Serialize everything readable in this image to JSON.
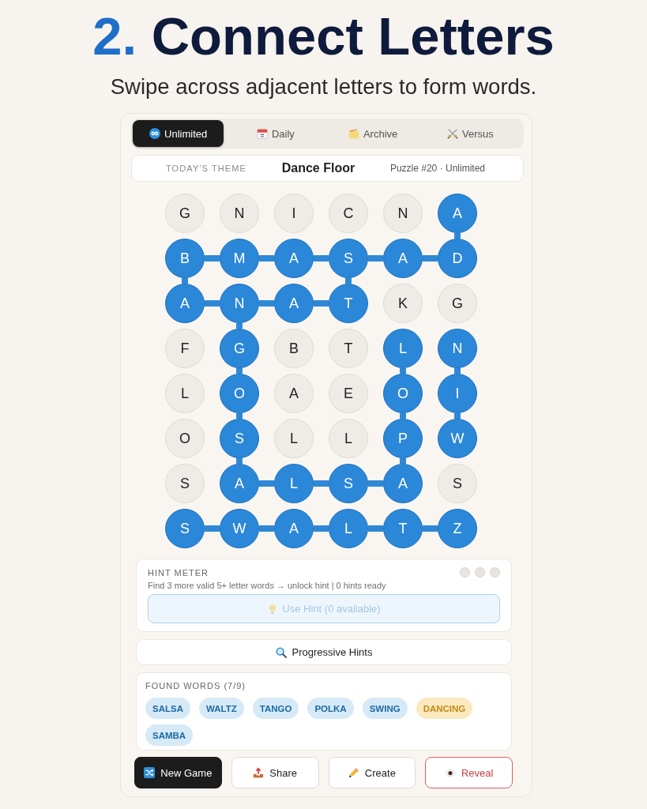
{
  "header": {
    "number": "2.",
    "title": "Connect Letters",
    "subtitle": "Swipe across adjacent letters to form words."
  },
  "tabs": [
    {
      "label": "Unlimited",
      "selected": true
    },
    {
      "label": "Daily",
      "selected": false
    },
    {
      "label": "Archive",
      "selected": false
    },
    {
      "label": "Versus",
      "selected": false
    }
  ],
  "theme_bar": {
    "label": "TODAY'S THEME",
    "theme": "Dance Floor",
    "puzzle": "Puzzle #20 · Unlimited"
  },
  "grid": {
    "rows": [
      [
        {
          "letter": "G",
          "selected": false,
          "link_right": false,
          "link_down": false
        },
        {
          "letter": "N",
          "selected": false,
          "link_right": false,
          "link_down": false
        },
        {
          "letter": "I",
          "selected": false,
          "link_right": false,
          "link_down": false
        },
        {
          "letter": "C",
          "selected": false,
          "link_right": false,
          "link_down": false
        },
        {
          "letter": "N",
          "selected": false,
          "link_right": false,
          "link_down": false
        },
        {
          "letter": "A",
          "selected": true,
          "link_right": false,
          "link_down": true
        }
      ],
      [
        {
          "letter": "B",
          "selected": true,
          "link_right": true,
          "link_down": true
        },
        {
          "letter": "M",
          "selected": true,
          "link_right": true,
          "link_down": false
        },
        {
          "letter": "A",
          "selected": true,
          "link_right": true,
          "link_down": false
        },
        {
          "letter": "S",
          "selected": true,
          "link_right": true,
          "link_down": true
        },
        {
          "letter": "A",
          "selected": true,
          "link_right": true,
          "link_down": false
        },
        {
          "letter": "D",
          "selected": true,
          "link_right": false,
          "link_down": false
        }
      ],
      [
        {
          "letter": "A",
          "selected": true,
          "link_right": true,
          "link_down": false
        },
        {
          "letter": "N",
          "selected": true,
          "link_right": true,
          "link_down": true
        },
        {
          "letter": "A",
          "selected": true,
          "link_right": true,
          "link_down": false
        },
        {
          "letter": "T",
          "selected": true,
          "link_right": false,
          "link_down": false
        },
        {
          "letter": "K",
          "selected": false,
          "link_right": false,
          "link_down": false
        },
        {
          "letter": "G",
          "selected": false,
          "link_right": false,
          "link_down": false
        }
      ],
      [
        {
          "letter": "F",
          "selected": false,
          "link_right": false,
          "link_down": false
        },
        {
          "letter": "G",
          "selected": true,
          "link_right": false,
          "link_down": true
        },
        {
          "letter": "B",
          "selected": false,
          "link_right": false,
          "link_down": false
        },
        {
          "letter": "T",
          "selected": false,
          "link_right": false,
          "link_down": false
        },
        {
          "letter": "L",
          "selected": true,
          "link_right": false,
          "link_down": true
        },
        {
          "letter": "N",
          "selected": true,
          "link_right": false,
          "link_down": true
        }
      ],
      [
        {
          "letter": "L",
          "selected": false,
          "link_right": false,
          "link_down": false
        },
        {
          "letter": "O",
          "selected": true,
          "link_right": false,
          "link_down": true
        },
        {
          "letter": "A",
          "selected": false,
          "link_right": false,
          "link_down": false
        },
        {
          "letter": "E",
          "selected": false,
          "link_right": false,
          "link_down": false
        },
        {
          "letter": "O",
          "selected": true,
          "link_right": false,
          "link_down": true
        },
        {
          "letter": "I",
          "selected": true,
          "link_right": false,
          "link_down": true
        }
      ],
      [
        {
          "letter": "O",
          "selected": false,
          "link_right": false,
          "link_down": false
        },
        {
          "letter": "S",
          "selected": true,
          "link_right": false,
          "link_down": true
        },
        {
          "letter": "L",
          "selected": false,
          "link_right": false,
          "link_down": false
        },
        {
          "letter": "L",
          "selected": false,
          "link_right": false,
          "link_down": false
        },
        {
          "letter": "P",
          "selected": true,
          "link_right": false,
          "link_down": true
        },
        {
          "letter": "W",
          "selected": true,
          "link_right": false,
          "link_down": false
        }
      ],
      [
        {
          "letter": "S",
          "selected": false,
          "link_right": false,
          "link_down": false
        },
        {
          "letter": "A",
          "selected": true,
          "link_right": true,
          "link_down": false
        },
        {
          "letter": "L",
          "selected": true,
          "link_right": true,
          "link_down": false
        },
        {
          "letter": "S",
          "selected": true,
          "link_right": true,
          "link_down": false
        },
        {
          "letter": "A",
          "selected": true,
          "link_right": false,
          "link_down": false
        },
        {
          "letter": "S",
          "selected": false,
          "link_right": false,
          "link_down": false
        }
      ],
      [
        {
          "letter": "S",
          "selected": true,
          "link_right": true,
          "link_down": false
        },
        {
          "letter": "W",
          "selected": true,
          "link_right": true,
          "link_down": false
        },
        {
          "letter": "A",
          "selected": true,
          "link_right": true,
          "link_down": false
        },
        {
          "letter": "L",
          "selected": true,
          "link_right": true,
          "link_down": false
        },
        {
          "letter": "T",
          "selected": true,
          "link_right": true,
          "link_down": false
        },
        {
          "letter": "Z",
          "selected": true,
          "link_right": false,
          "link_down": false
        }
      ]
    ]
  },
  "hint_meter": {
    "title": "HINT METER",
    "slots": [
      {
        "filled": false
      },
      {
        "filled": false
      },
      {
        "filled": false
      }
    ],
    "message": "Find 3 more valid 5+ letter words → unlock hint | 0 hints ready",
    "button": {
      "label": "Use Hint (0 available)",
      "disabled": true
    }
  },
  "progressive_hints": {
    "label": "Progressive Hints"
  },
  "found_words": {
    "title": "FOUND WORDS (7/9)",
    "words": [
      {
        "word": "SALSA",
        "kind": "word"
      },
      {
        "word": "WALTZ",
        "kind": "word"
      },
      {
        "word": "TANGO",
        "kind": "word"
      },
      {
        "word": "POLKA",
        "kind": "word"
      },
      {
        "word": "SWING",
        "kind": "word"
      },
      {
        "word": "DANCING",
        "kind": "theme"
      },
      {
        "word": "SAMBA",
        "kind": "word"
      }
    ]
  },
  "actions": [
    {
      "label": "New Game",
      "kind": "primary"
    },
    {
      "label": "Share",
      "kind": "default"
    },
    {
      "label": "Create",
      "kind": "default"
    },
    {
      "label": "Reveal",
      "kind": "danger"
    }
  ]
}
